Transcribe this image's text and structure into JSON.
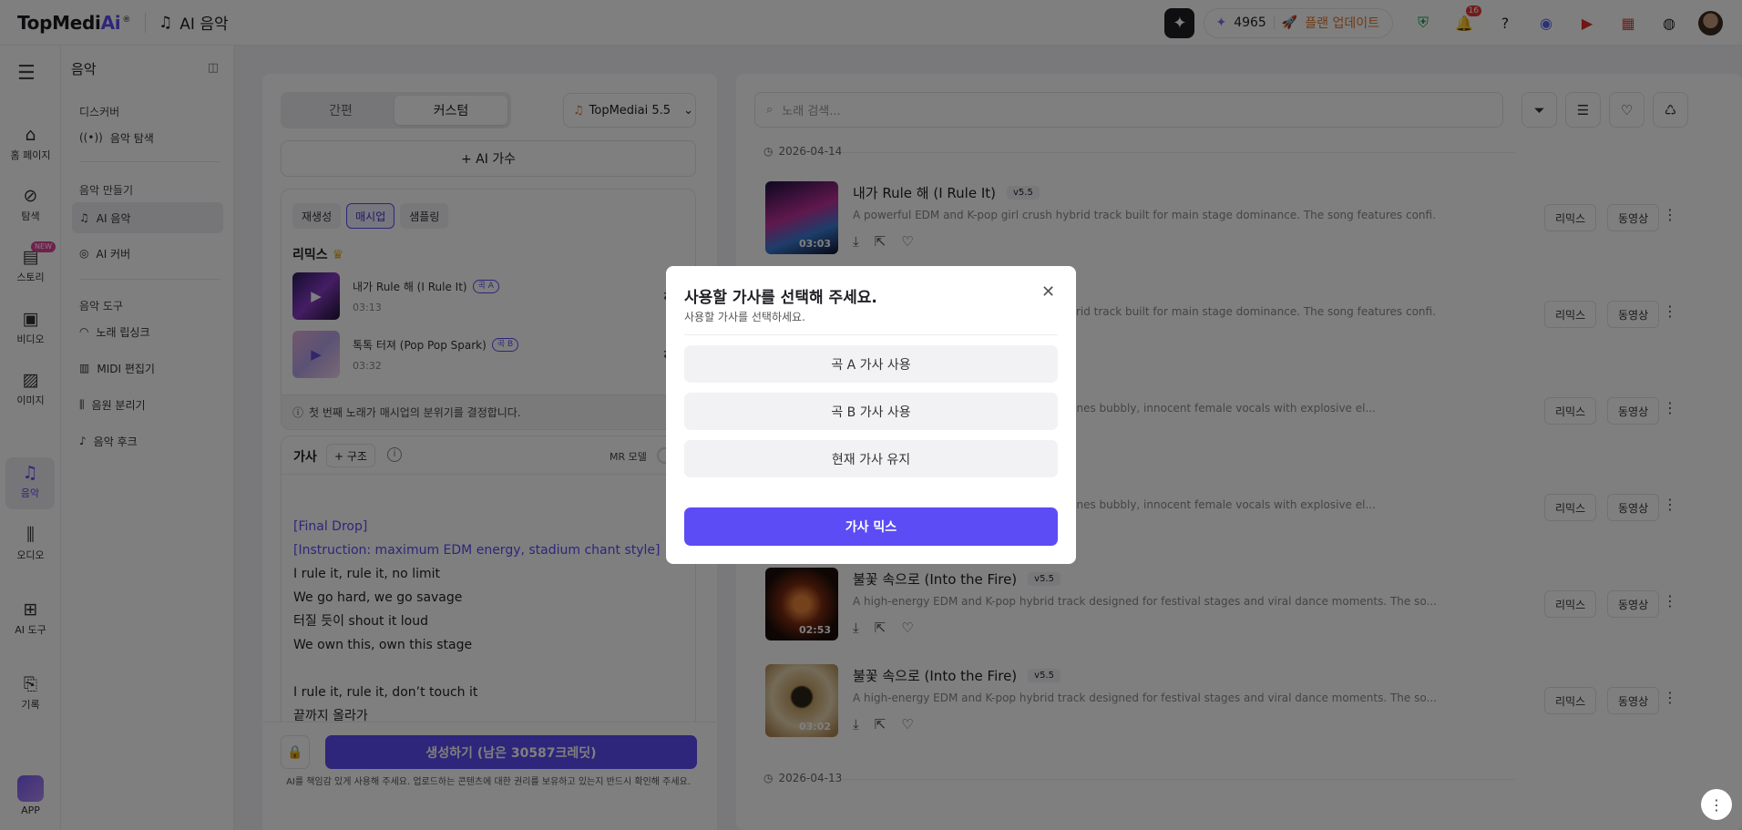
{
  "topbar": {
    "logo_main": "TopMedi",
    "logo_ai": "Ai",
    "logo_mark": "®",
    "breadcrumb": "AI 음악",
    "credits": "4965",
    "upgrade": "플랜 업데이트",
    "notif_count": "16"
  },
  "rail": {
    "items": [
      {
        "label": "홈 페이지",
        "icon": "home-icon"
      },
      {
        "label": "탐색",
        "icon": "compass-icon"
      },
      {
        "label": "스토리",
        "icon": "story-icon",
        "badge": "NEW"
      },
      {
        "label": "비디오",
        "icon": "video-icon"
      },
      {
        "label": "이미지",
        "icon": "image-icon"
      },
      {
        "label": "음악",
        "icon": "music-icon"
      },
      {
        "label": "오디오",
        "icon": "audio-icon"
      },
      {
        "label": "AI 도구",
        "icon": "tools-icon"
      },
      {
        "label": "기록",
        "icon": "history-icon"
      },
      {
        "label": "APP",
        "icon": "app-icon"
      }
    ]
  },
  "subnav": {
    "title": "음악",
    "sec_discover": "디스커버",
    "discover_item": "음악 탐색",
    "sec_make": "음악 만들기",
    "make_items": [
      "AI 음악",
      "AI 커버"
    ],
    "sec_tools": "음악 도구",
    "tool_items": [
      "노래 립싱크",
      "MIDI 편집기",
      "음원 분리기",
      "음악 후크"
    ]
  },
  "panel": {
    "tabs": [
      "간편",
      "커스텀"
    ],
    "model": "TopMediai 5.5",
    "ai_singer": "+ AI 가수",
    "chips": [
      "재생성",
      "매시업",
      "샘플링"
    ],
    "remix_title": "리믹스",
    "tracks": [
      {
        "name": "내가 Rule 해 (I Rule It)",
        "tag": "곡 A",
        "dur": "03:13"
      },
      {
        "name": "톡톡 터져 (Pop Pop Spark)",
        "tag": "곡 B",
        "dur": "03:32"
      }
    ],
    "note": "첫 번째 노래가 매시업의 분위기를 결정합니다.",
    "lyrics_title": "가사",
    "structure": "+ 구조",
    "mr_mode": "MR 모델",
    "lyrics": {
      "l1": "[Final Drop]",
      "l2": "[Instruction: maximum EDM energy, stadium chant style]",
      "l3": "I rule it, rule it, no limit",
      "l4": "We go hard, we go savage",
      "l5": "터질 듯이 shout it loud",
      "l6": "We own this, own this stage",
      "l7": "I rule it, rule it, don’t touch it",
      "l8": "끝까지 올라가"
    },
    "generate": "생성하기 (남은 30587크레딧)",
    "disclaimer": "AI를 책임감 있게 사용해 주세요. 업로드하는 콘텐츠에 대한 권리를 보유하고 있는지 반드시 확인해 주세요."
  },
  "library": {
    "search_placeholder": "노래 검색...",
    "date1": "2026-04-14",
    "date2": "2026-04-13",
    "remix_label": "리믹스",
    "video_label": "동영상",
    "songs": [
      {
        "title": "내가 Rule 해 (I Rule It)",
        "ver": "v5.5",
        "desc": "A powerful EDM and K-pop girl crush hybrid track built for main stage dominance. The song features confi...",
        "dur": "03:03"
      },
      {
        "title": "",
        "ver": "",
        "desc": "A powerful EDM and K-pop girl crush hybrid track built for main stage dominance. The song features confi...",
        "dur": ""
      },
      {
        "title": "",
        "ver": "",
        "desc": "A bright EDM and K-pop track that combines bubbly, innocent female vocals with explosive el...",
        "dur": ""
      },
      {
        "title": "",
        "ver": "",
        "desc": "A bright EDM and K-pop track that combines bubbly, innocent female vocals with explosive el...",
        "dur": ""
      },
      {
        "title": "불꽃 속으로 (Into the Fire)",
        "ver": "v5.5",
        "desc": "A high-energy EDM and K-pop hybrid track designed for festival stages and viral dance moments. The so...",
        "dur": "02:53"
      },
      {
        "title": "불꽃 속으로 (Into the Fire)",
        "ver": "v5.5",
        "desc": "A high-energy EDM and K-pop hybrid track designed for festival stages and viral dance moments. The so...",
        "dur": "03:02"
      }
    ]
  },
  "modal": {
    "title": "사용할 가사를 선택해 주세요.",
    "subtitle": "사용할 가사를 선택하세요.",
    "options": [
      "곡 A 가사 사용",
      "곡 B 가사 사용",
      "현재 가사 유지"
    ],
    "confirm": "가사 믹스"
  },
  "colors": {
    "accent": "#5b4cf5",
    "upgrade": "#e0762e"
  }
}
